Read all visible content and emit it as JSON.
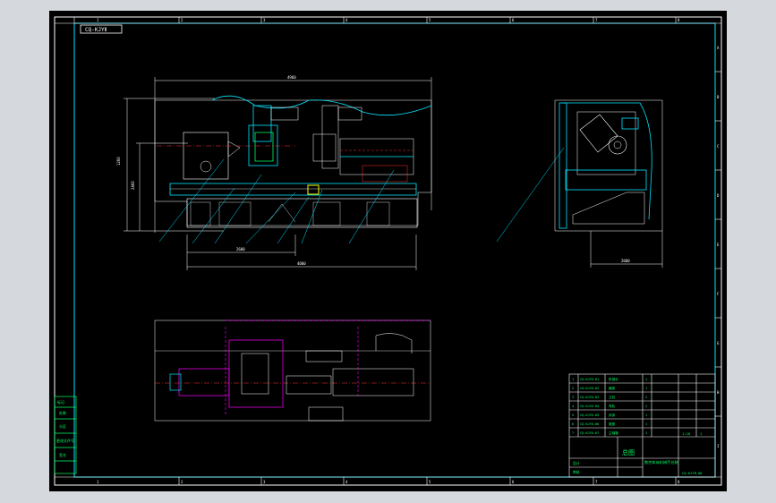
{
  "app": {
    "bg_color": "#d5d9dd",
    "canvas_color": "#000000"
  },
  "frame": {
    "drawing_code": "CQ-KJYⅡ",
    "ruler_numbers": [
      "1",
      "2",
      "3",
      "4",
      "5",
      "6",
      "7",
      "8"
    ],
    "row_letters": [
      "A",
      "B",
      "C",
      "D",
      "E",
      "F",
      "G",
      "H",
      "I"
    ]
  },
  "dimensions": {
    "front_top": "4960",
    "front_height": "1260",
    "front_inner_height": "2460",
    "front_bottom_1": "2600",
    "front_bottom_2": "4000",
    "side_bottom": "2000"
  },
  "title_block": {
    "drawing_title": "总图",
    "product_name": "数控车床机械手总装",
    "drawing_number": "CQ-KJYⅡ-00",
    "scale": "1:10",
    "sheet": "1",
    "designer_label": "设计",
    "check_label": "审核",
    "parts_rows": [
      [
        "1",
        "CQ-KJYⅡ-01",
        "机械手",
        "1"
      ],
      [
        "2",
        "CQ-KJYⅡ-02",
        "横梁",
        "1"
      ],
      [
        "3",
        "CQ-KJYⅡ-03",
        "立柱",
        "2"
      ],
      [
        "4",
        "CQ-KJYⅡ-04",
        "导轨",
        "2"
      ],
      [
        "5",
        "CQ-KJYⅡ-05",
        "床身",
        "1"
      ],
      [
        "6",
        "CQ-KJYⅡ-06",
        "尾座",
        "1"
      ],
      [
        "7",
        "CQ-KJYⅡ-07",
        "主轴箱",
        "1"
      ],
      [
        "8",
        "CQ-KJYⅡ-08",
        "底座",
        "1"
      ]
    ]
  },
  "revision_box": [
    "标记",
    "处数",
    "分区",
    "更改文件号",
    "签名"
  ]
}
